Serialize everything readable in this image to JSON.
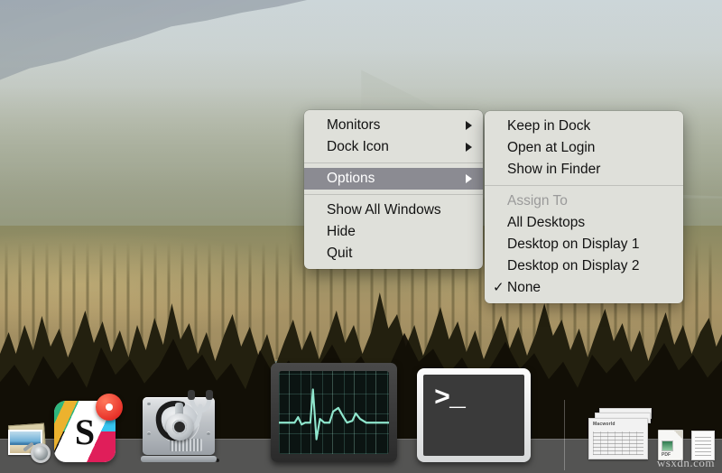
{
  "desktop": {
    "wallpaper_name": "mountain-forest-haze",
    "colors": {
      "sky": "#ccd6d9",
      "forest": "#a89466",
      "trees": "#23200f",
      "dock_bg": "#545453"
    }
  },
  "context_menu": {
    "name": "dock-icon-context-menu",
    "items": [
      {
        "label": "Monitors",
        "has_submenu": true,
        "selected": false
      },
      {
        "label": "Dock Icon",
        "has_submenu": true,
        "selected": false
      },
      {
        "separator": true
      },
      {
        "label": "Options",
        "has_submenu": true,
        "selected": true
      },
      {
        "separator": true
      },
      {
        "label": "Show All Windows",
        "has_submenu": false,
        "selected": false
      },
      {
        "label": "Hide",
        "has_submenu": false,
        "selected": false
      },
      {
        "label": "Quit",
        "has_submenu": false,
        "selected": false
      }
    ]
  },
  "options_submenu": {
    "name": "options-submenu",
    "items": [
      {
        "label": "Keep in Dock",
        "disabled": false,
        "checked": false
      },
      {
        "label": "Open at Login",
        "disabled": false,
        "checked": false
      },
      {
        "label": "Show in Finder",
        "disabled": false,
        "checked": false
      },
      {
        "separator": true
      },
      {
        "label": "Assign To",
        "disabled": true,
        "checked": false
      },
      {
        "label": "All Desktops",
        "disabled": false,
        "checked": false
      },
      {
        "label": "Desktop on Display 1",
        "disabled": false,
        "checked": false
      },
      {
        "label": "Desktop on Display 2",
        "disabled": false,
        "checked": false
      },
      {
        "label": "None",
        "disabled": false,
        "checked": true
      }
    ],
    "check_glyph": "✓"
  },
  "dock": {
    "items": [
      {
        "name": "preview",
        "label": "Preview",
        "running": false
      },
      {
        "name": "slack",
        "label": "Slack",
        "running": true,
        "badge": "recording"
      },
      {
        "name": "disk-utility",
        "label": "Disk Utility",
        "running": false
      },
      {
        "name": "activity-monitor",
        "label": "Activity Monitor",
        "running": true
      },
      {
        "name": "terminal",
        "label": "Terminal",
        "running": true
      }
    ],
    "terminal_prompt": ">_",
    "stack_items": [
      {
        "name": "documents-stack",
        "label": "Macworld"
      },
      {
        "name": "pdf-file",
        "label": "PDF"
      },
      {
        "name": "text-document",
        "label": "Document"
      }
    ]
  },
  "watermark": {
    "text": "wsxdn.com"
  }
}
